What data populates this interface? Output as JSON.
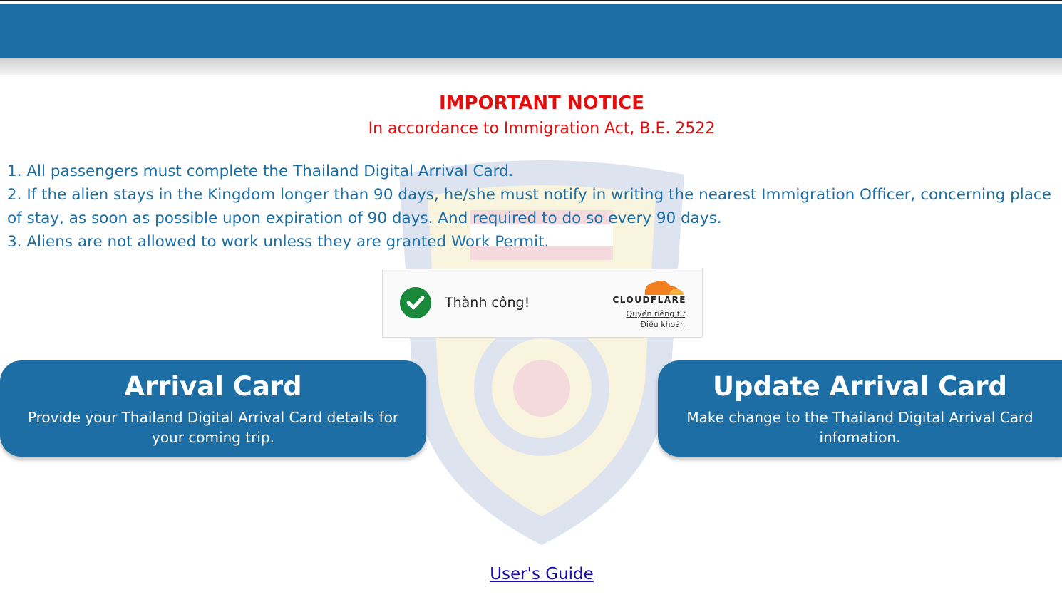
{
  "notice": {
    "title": "IMPORTANT NOTICE",
    "subtitle": "In accordance to Immigration Act, B.E. 2522"
  },
  "rules": [
    "1. All passengers must complete the Thailand Digital Arrival Card.",
    "2. If the alien stays in the Kingdom longer than 90 days, he/she must notify in writing the nearest Immigration Officer, concerning place of stay, as soon as possible upon expiration of 90 days. And required to do so every 90 days.",
    "3. Aliens are not allowed to work unless they are granted Work Permit."
  ],
  "captcha": {
    "status": "Thành công!",
    "brand": "CLOUDFLARE",
    "privacy": "Quyền riêng tư",
    "terms": "Điều khoản"
  },
  "arrival_card": {
    "title": "Arrival Card",
    "description": "Provide your Thailand Digital Arrival Card details for your coming trip."
  },
  "update_card": {
    "title": "Update Arrival Card",
    "description": "Make change to the Thailand Digital Arrival Card infomation."
  },
  "footer": {
    "guide_link": "User's Guide"
  },
  "colors": {
    "header": "#1c6ea4",
    "notice": "#e30f0f",
    "rules_text": "#1c6ea4",
    "button": "#1c6ea4",
    "success": "#1a8a3a",
    "cloudflare_orange": "#f38020"
  }
}
